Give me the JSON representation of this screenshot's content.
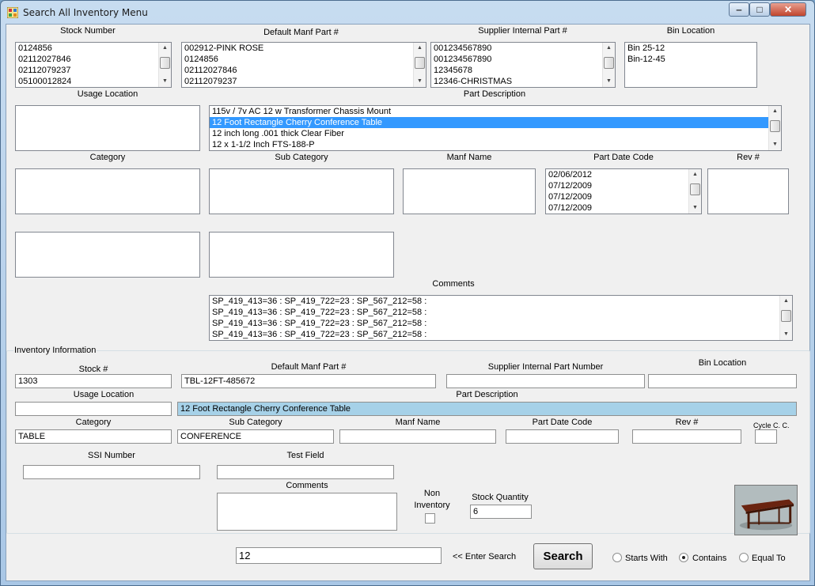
{
  "window": {
    "title": "Search All Inventory Menu",
    "controls": {
      "minimize": "‒",
      "maximize": "□",
      "close": "✕"
    }
  },
  "lists": {
    "stock_number": {
      "label": "Stock Number",
      "items": [
        "0124856",
        "02112027846",
        "02112079237",
        "05100012824"
      ]
    },
    "default_manf_part": {
      "label": "Default Manf Part #",
      "items": [
        "002912-PINK ROSE",
        "0124856",
        "02112027846",
        "02112079237"
      ]
    },
    "supplier_internal_part": {
      "label": "Supplier Internal Part #",
      "items": [
        "001234567890",
        "001234567890",
        "12345678",
        "12346-CHRISTMAS"
      ]
    },
    "bin_location": {
      "label": "Bin Location",
      "items": [
        "Bin 25-12",
        "Bin-12-45"
      ]
    },
    "usage_location": {
      "label": "Usage Location",
      "items": []
    },
    "part_description": {
      "label": "Part Description",
      "items": [
        "115v / 7v AC  12 w Transformer Chassis Mount",
        "12 Foot Rectangle Cherry Conference Table",
        "12 inch long .001 thick Clear Fiber",
        "12 x 1-1/2 Inch FTS-188-P"
      ],
      "selected_index": 1
    },
    "category": {
      "label": "Category",
      "items": []
    },
    "sub_category": {
      "label": "Sub Category",
      "items": []
    },
    "manf_name": {
      "label": "Manf Name",
      "items": []
    },
    "part_date_code": {
      "label": "Part Date Code",
      "items": [
        "02/06/2012",
        "07/12/2009",
        "07/12/2009",
        "07/12/2009"
      ]
    },
    "rev": {
      "label": "Rev #",
      "items": []
    },
    "comments": {
      "label": "Comments",
      "items": [
        "SP_419_413=36 : SP_419_722=23 : SP_567_212=58 :",
        "SP_419_413=36 : SP_419_722=23 : SP_567_212=58 :",
        "SP_419_413=36 : SP_419_722=23 : SP_567_212=58 :",
        "SP_419_413=36 : SP_419_722=23 : SP_567_212=58 :"
      ]
    }
  },
  "inventory": {
    "group_title": "Inventory Information",
    "stock": {
      "label": "Stock #",
      "value": "1303"
    },
    "default_manf_part": {
      "label": "Default Manf Part #",
      "value": "TBL-12FT-485672"
    },
    "supplier_internal_part": {
      "label": "Supplier Internal Part Number",
      "value": ""
    },
    "bin_location": {
      "label": "Bin Location",
      "value": ""
    },
    "usage_location": {
      "label": "Usage Location",
      "value": ""
    },
    "part_description": {
      "label": "Part Description",
      "value": "12 Foot Rectangle Cherry Conference Table"
    },
    "category": {
      "label": "Category",
      "value": "TABLE"
    },
    "sub_category": {
      "label": "Sub Category",
      "value": "CONFERENCE"
    },
    "manf_name": {
      "label": "Manf Name",
      "value": ""
    },
    "part_date_code": {
      "label": "Part Date Code",
      "value": ""
    },
    "rev": {
      "label": "Rev #",
      "value": ""
    },
    "cycle_cc": {
      "label": "Cycle C. C.",
      "value": ""
    },
    "ssi_number": {
      "label": "SSI Number",
      "value": ""
    },
    "test_field": {
      "label": "Test Field",
      "value": ""
    },
    "comments": {
      "label": "Comments",
      "value": ""
    },
    "non_inventory": {
      "label_line1": "Non",
      "label_line2": "Inventory",
      "checked": false
    },
    "stock_quantity": {
      "label": "Stock Quantity",
      "value": "6"
    },
    "photo_icon": "conference-table-photo"
  },
  "search": {
    "value": "12",
    "hint": "<< Enter Search",
    "button_label": "Search",
    "options": [
      {
        "label": "Starts With",
        "selected": false
      },
      {
        "label": "Contains",
        "selected": true
      },
      {
        "label": "Equal To",
        "selected": false
      }
    ]
  },
  "colors": {
    "selection": "#3399ff",
    "highlight_field": "#a6d1e8",
    "window_frame": "#a9c7e6"
  }
}
